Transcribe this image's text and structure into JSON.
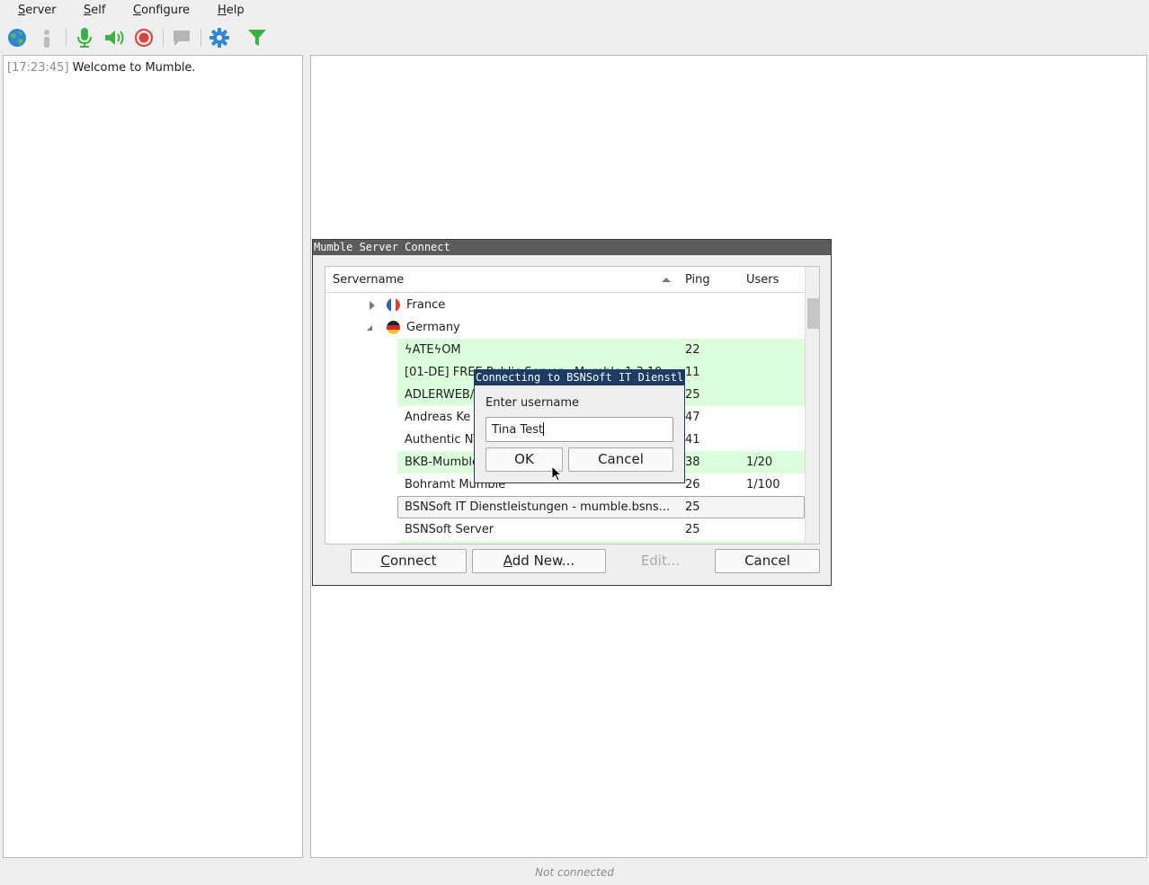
{
  "menu": {
    "items": [
      {
        "mnemonic": "S",
        "rest": "erver"
      },
      {
        "mnemonic": "S",
        "rest": "elf"
      },
      {
        "mnemonic": "C",
        "rest": "onfigure"
      },
      {
        "mnemonic": "H",
        "rest": "elp"
      }
    ]
  },
  "toolbar": {
    "icons": [
      "globe-icon",
      "info-icon",
      "microphone-icon",
      "speaker-icon",
      "record-icon",
      "chat-icon",
      "gear-icon",
      "filter-icon"
    ]
  },
  "log": {
    "timestamp": "[17:23:45]",
    "message": "Welcome to Mumble."
  },
  "status": {
    "text": "Not connected"
  },
  "connect_dialog": {
    "title": "Mumble Server Connect",
    "columns": {
      "name": "Servername",
      "ping": "Ping",
      "users": "Users"
    },
    "countries": [
      {
        "name": "France",
        "expanded": false
      },
      {
        "name": "Germany",
        "expanded": true
      }
    ],
    "servers": [
      {
        "name": "ϟATEϟOM",
        "ping": "22",
        "users": ""
      },
      {
        "name": "[01-DE] FREE Public Server - Mumble 1.3.10",
        "ping": "11",
        "users": ""
      },
      {
        "name": "ADLERWEB/",
        "ping": "25",
        "users": ""
      },
      {
        "name": "Andreas Ke",
        "ping": "47",
        "users": ""
      },
      {
        "name": "Authentic NT",
        "ping": "41",
        "users": ""
      },
      {
        "name": "BKB-Mumble",
        "ping": "38",
        "users": "1/20"
      },
      {
        "name": "Bohramt Mumble",
        "ping": "26",
        "users": "1/100"
      },
      {
        "name": "BSNSoft IT Dienstleistungen - mumble.bsns...",
        "ping": "25",
        "users": ""
      },
      {
        "name": "BSNSoft Server",
        "ping": "25",
        "users": ""
      }
    ],
    "buttons": {
      "connect_mn": "C",
      "connect_rest": "onnect",
      "add_mn": "A",
      "add_rest": "dd New...",
      "edit": "Edit...",
      "cancel": "Cancel"
    }
  },
  "username_prompt": {
    "title": "Connecting to BSNSoft IT Dienstleistungen",
    "label": "Enter username",
    "value": "Tina Test",
    "ok": "OK",
    "cancel": "Cancel"
  }
}
